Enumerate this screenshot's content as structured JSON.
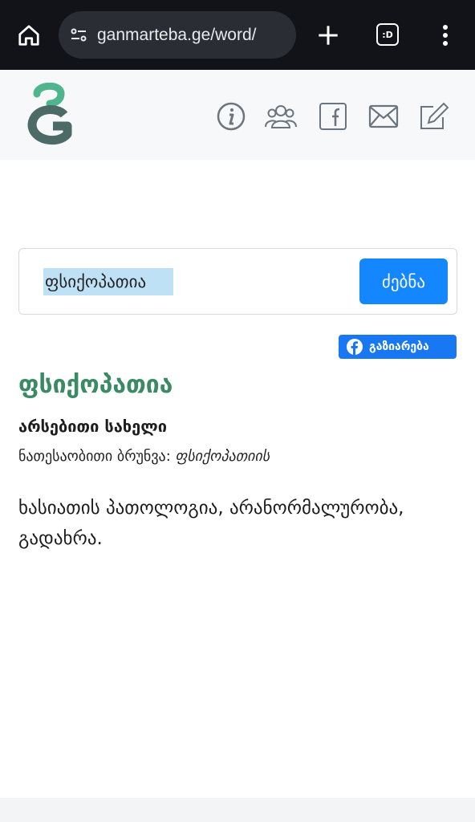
{
  "browser": {
    "url": "ganmarteba.ge/word/",
    "tab_badge": ":D"
  },
  "search": {
    "value": "ფსიქოპათია",
    "button_label": "ძებნა"
  },
  "share": {
    "label": "გაზიარება"
  },
  "entry": {
    "word": "ფსიქოპათია",
    "part_of_speech": "არსებითი სახელი",
    "genitive_label": "ნათესაობითი ბრუნვა:",
    "genitive_form": "ფსიქოპათიის",
    "definition": "ხასიათის პათოლოგია, არანორმალურობა, გადახრა."
  },
  "colors": {
    "accent_green": "#3a8a64",
    "button_blue": "#1487ff",
    "facebook_blue": "#1877f2",
    "icon_gray": "#6c757d"
  }
}
